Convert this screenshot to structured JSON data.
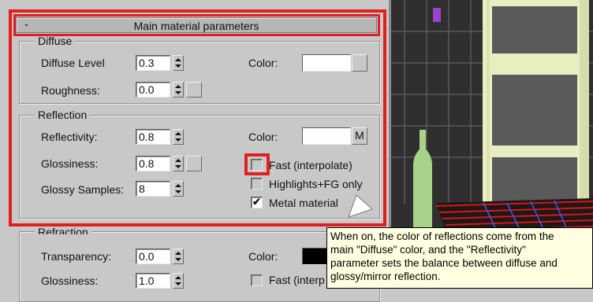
{
  "rollout": {
    "collapse_symbol": "-",
    "title": "Main material parameters"
  },
  "diffuse": {
    "group_label": "Diffuse",
    "level_label": "Diffuse Level",
    "level_value": "0.3",
    "roughness_label": "Roughness:",
    "roughness_value": "0.0",
    "color_label": "Color:",
    "color": "#ffffff"
  },
  "reflection": {
    "group_label": "Reflection",
    "reflectivity_label": "Reflectivity:",
    "reflectivity_value": "0.8",
    "glossiness_label": "Glossiness:",
    "glossiness_value": "0.8",
    "glossy_samples_label": "Glossy Samples:",
    "glossy_samples_value": "8",
    "color_label": "Color:",
    "color": "#ffffff",
    "map_button_label": "M",
    "fast_label": "Fast (interpolate)",
    "fast_checked": false,
    "highlights_label": "Highlights+FG only",
    "highlights_checked": false,
    "metal_label": "Metal material",
    "metal_checked": true,
    "check_mark": "✔"
  },
  "refraction": {
    "group_label": "Refraction",
    "transparency_label": "Transparency:",
    "transparency_value": "0.0",
    "glossiness_label": "Glossiness:",
    "glossiness_value": "1.0",
    "color_label": "Color:",
    "color": "#000000",
    "fast_label": "Fast (interp"
  },
  "tooltip": {
    "lines": [
      "When on, the color of reflections come from the",
      "main \"Diffuse\" color, and the \"Reflectivity\"",
      "parameter sets the balance between diffuse and",
      "glossy/mirror reflection."
    ]
  },
  "colors": {
    "highlight": "#e02020",
    "panel_bg": "#c8c8c8",
    "tooltip_bg": "#ffffe1"
  }
}
